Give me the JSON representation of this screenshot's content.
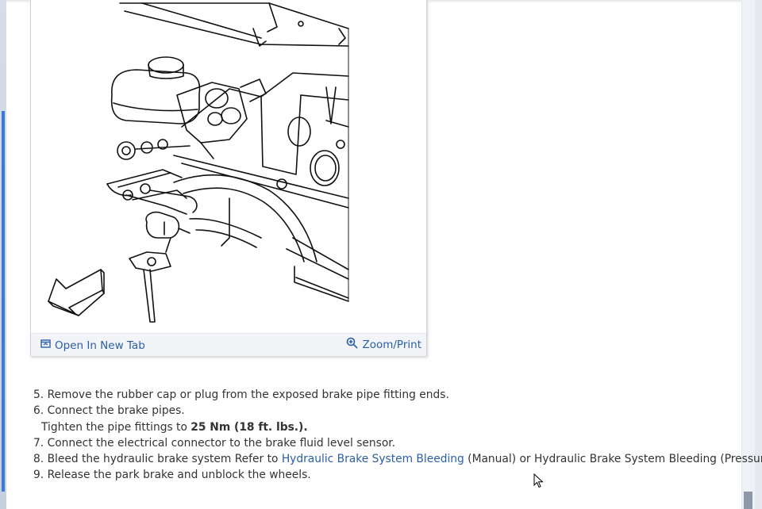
{
  "figure": {
    "open_new_tab_label": "Open In New Tab",
    "zoom_print_label": "Zoom/Print"
  },
  "steps": [
    {
      "number": "5.",
      "text": "Remove the rubber cap or plug from the exposed brake pipe fitting ends."
    },
    {
      "number": "6.",
      "text": "Connect the brake pipes."
    },
    {
      "prefix": "Tighten the pipe fittings to ",
      "bold": "25 Nm (18 ft. lbs.)."
    },
    {
      "number": "7.",
      "text": "Connect the electrical connector to the brake fluid level sensor."
    },
    {
      "number": "8.",
      "text_before": "Bleed the hydraulic brake system Refer to ",
      "link": "Hydraulic Brake System Bleeding",
      "text_after": " (Manual) or Hydraulic Brake System Bleeding (Pressure)."
    },
    {
      "number": "9.",
      "text": "Release the park brake and unblock the wheels."
    }
  ],
  "icons": {
    "open_tab": "open-tab-icon",
    "zoom": "zoom-icon"
  },
  "colors": {
    "link": "#2a5fa8",
    "footer_bg": "#f2f4f7",
    "scroll_accent": "#3d7ad6"
  }
}
